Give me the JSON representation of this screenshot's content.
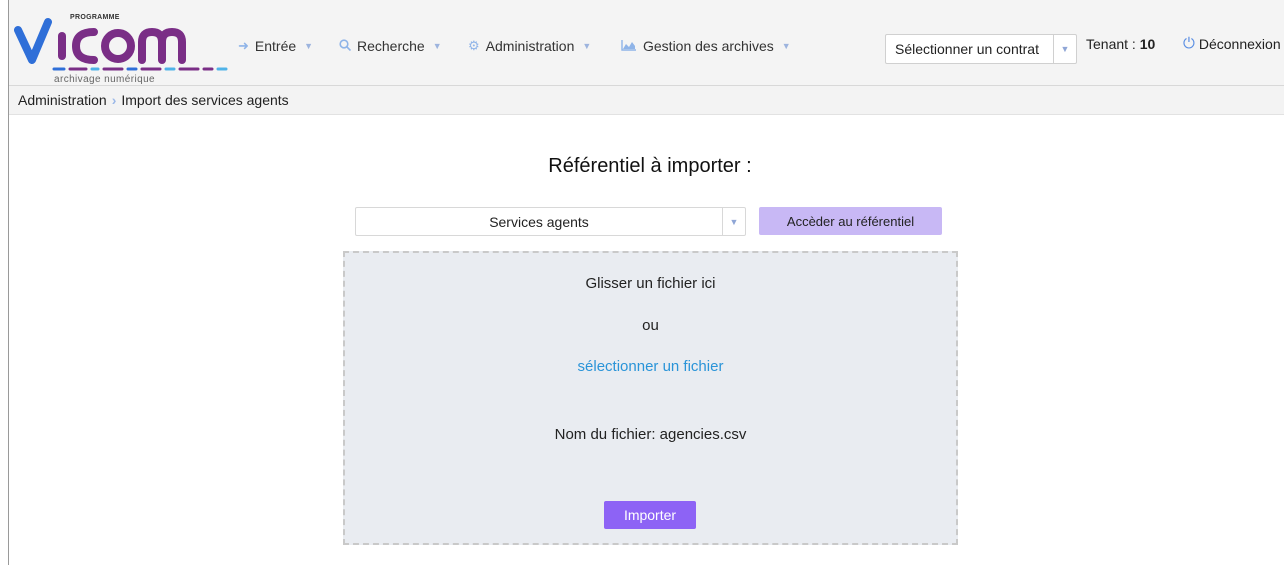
{
  "header": {
    "logo": {
      "program": "PROGRAMME",
      "name": "vitam",
      "subtitle": "archivage numérique"
    },
    "nav": [
      {
        "label": "Entrée",
        "icon": "login-arrow-icon"
      },
      {
        "label": "Recherche",
        "icon": "search-icon"
      },
      {
        "label": "Administration",
        "icon": "gears-icon"
      },
      {
        "label": "Gestion des archives",
        "icon": "area-chart-icon"
      }
    ],
    "contract_select": {
      "value": "Sélectionner un contrat"
    },
    "tenant": {
      "label": "Tenant :",
      "value": "10"
    },
    "logout_label": "Déconnexion"
  },
  "breadcrumb": {
    "parent": "Administration",
    "current": "Import des services agents"
  },
  "main": {
    "title": "Référentiel à importer :",
    "referential_select": {
      "value": "Services agents"
    },
    "access_button": "Accèder au référentiel",
    "dropzone": {
      "drag_text": "Glisser un fichier ici",
      "or_text": "ou",
      "select_link": "sélectionner un fichier",
      "file_name_label": "Nom du fichier: agencies.csv"
    },
    "import_button": "Importer"
  },
  "colors": {
    "accent_purple": "#8d63f5",
    "button_light_purple": "#c8b8f5",
    "link_blue": "#2a94d8",
    "logo_purple": "#7a2e86",
    "logo_blue": "#2f6fd8"
  }
}
